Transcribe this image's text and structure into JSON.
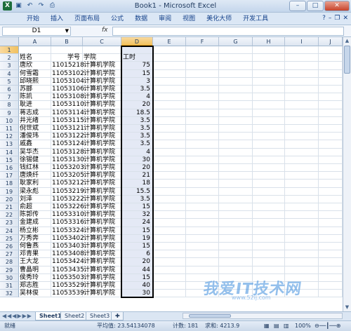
{
  "window": {
    "title": "Book1 - Microsoft Excel"
  },
  "qat_icons": [
    "excel-logo-icon",
    "save-icon",
    "undo-icon",
    "redo-icon",
    "print-icon"
  ],
  "ribbon": {
    "tabs": [
      "开始",
      "插入",
      "页面布局",
      "公式",
      "数据",
      "审阅",
      "视图",
      "美化大师",
      "开发工具"
    ]
  },
  "formula_bar": {
    "name_box": "D1",
    "fx_label": "fx",
    "content": ""
  },
  "columns": [
    "A",
    "B",
    "C",
    "D",
    "E",
    "F",
    "G",
    "H",
    "I",
    "J"
  ],
  "selected_column": "D",
  "rows": [
    {
      "n": "1",
      "a": "",
      "b": "",
      "c": "",
      "d": ""
    },
    {
      "n": "2",
      "a": "姓名",
      "b": "学号",
      "c": "学院",
      "d": "工时"
    },
    {
      "n": "3",
      "a": "唐欣",
      "b": "11015218",
      "c": "计算机学院",
      "d": "75"
    },
    {
      "n": "4",
      "a": "何雪霜",
      "b": "11053102",
      "c": "计算机学院",
      "d": "15"
    },
    {
      "n": "5",
      "a": "邱晓熙",
      "b": "11053104",
      "c": "计算机学院",
      "d": "3"
    },
    {
      "n": "6",
      "a": "苏郦",
      "b": "11053106",
      "c": "计算机学院",
      "d": "3.5"
    },
    {
      "n": "7",
      "a": "陈凯",
      "b": "11053108",
      "c": "计算机学院",
      "d": "4"
    },
    {
      "n": "8",
      "a": "耿进",
      "b": "11053110",
      "c": "计算机学院",
      "d": "20"
    },
    {
      "n": "9",
      "a": "蒋志成",
      "b": "11053114",
      "c": "计算机学院",
      "d": "18.5"
    },
    {
      "n": "10",
      "a": "井光绪",
      "b": "11053115",
      "c": "计算机学院",
      "d": "3.5"
    },
    {
      "n": "11",
      "a": "  倪世斌",
      "b": "11053121",
      "c": "计算机学院",
      "d": "3.5"
    },
    {
      "n": "12",
      "a": "潘俊玮",
      "b": "11053122",
      "c": "计算机学院",
      "d": "3.5"
    },
    {
      "n": "13",
      "a": "戚鑫",
      "b": "11053124",
      "c": "计算机学院",
      "d": "3.5"
    },
    {
      "n": "14",
      "a": "吴华杰",
      "b": "11053128",
      "c": "计算机学院",
      "d": "4"
    },
    {
      "n": "15",
      "a": "徐锡健",
      "b": "11053130",
      "c": "计算机学院",
      "d": "30"
    },
    {
      "n": "16",
      "a": "钱红林",
      "b": "11053203",
      "c": "计算机学院",
      "d": "20"
    },
    {
      "n": "17",
      "a": "唐焕纤",
      "b": "11053205",
      "c": "计算机学院",
      "d": "21"
    },
    {
      "n": "18",
      "a": "耿家利",
      "b": "11053212",
      "c": "计算机学院",
      "d": "18"
    },
    {
      "n": "19",
      "a": "梁永彪",
      "b": "11053219",
      "c": "计算机学院",
      "d": "15.5"
    },
    {
      "n": "20",
      "a": "刘泽",
      "b": "11053222",
      "c": "计算机学院",
      "d": "3.5"
    },
    {
      "n": "21",
      "a": "俞超",
      "b": "11053226",
      "c": "计算机学院",
      "d": "15"
    },
    {
      "n": "22",
      "a": "陈郭传",
      "b": "11053310",
      "c": "计算机学院",
      "d": "32"
    },
    {
      "n": "23",
      "a": "金建成",
      "b": "11053316",
      "c": "计算机学院",
      "d": "24"
    },
    {
      "n": "24",
      "a": "杨立彬",
      "b": "11053324",
      "c": "计算机学院",
      "d": "15"
    },
    {
      "n": "25",
      "a": "万秀奔",
      "b": "11053402",
      "c": "计算机学院",
      "d": "19"
    },
    {
      "n": "26",
      "a": "何鲁燕",
      "b": "11053403",
      "c": "计算机学院",
      "d": "15"
    },
    {
      "n": "27",
      "a": "邓青果",
      "b": "11053408",
      "c": "计算机学院",
      "d": "6"
    },
    {
      "n": "28",
      "a": "王大龙",
      "b": "11053424",
      "c": "计算机学院",
      "d": "20"
    },
    {
      "n": "29",
      "a": "曹晶明",
      "b": "11053435",
      "c": "计算机学院",
      "d": "44"
    },
    {
      "n": "30",
      "a": "侯秀玲",
      "b": "11053503",
      "c": "计算机学院",
      "d": "15"
    },
    {
      "n": "31",
      "a": "郑志胜",
      "b": "11053529",
      "c": "计算机学院",
      "d": "40"
    },
    {
      "n": "32",
      "a": "吴林俊",
      "b": "11053539",
      "c": "计算机学院",
      "d": "30"
    }
  ],
  "sheet_tabs": [
    "Sheet1",
    "Sheet2",
    "Sheet3"
  ],
  "status": {
    "ready": "就绪",
    "average": "平均值: 23.54134078",
    "count": "计数: 181",
    "sum": "求和: 4213.9",
    "zoom": "100%"
  },
  "watermark": {
    "text": "我爱IT技术网",
    "sub": "www.52ij.com"
  }
}
